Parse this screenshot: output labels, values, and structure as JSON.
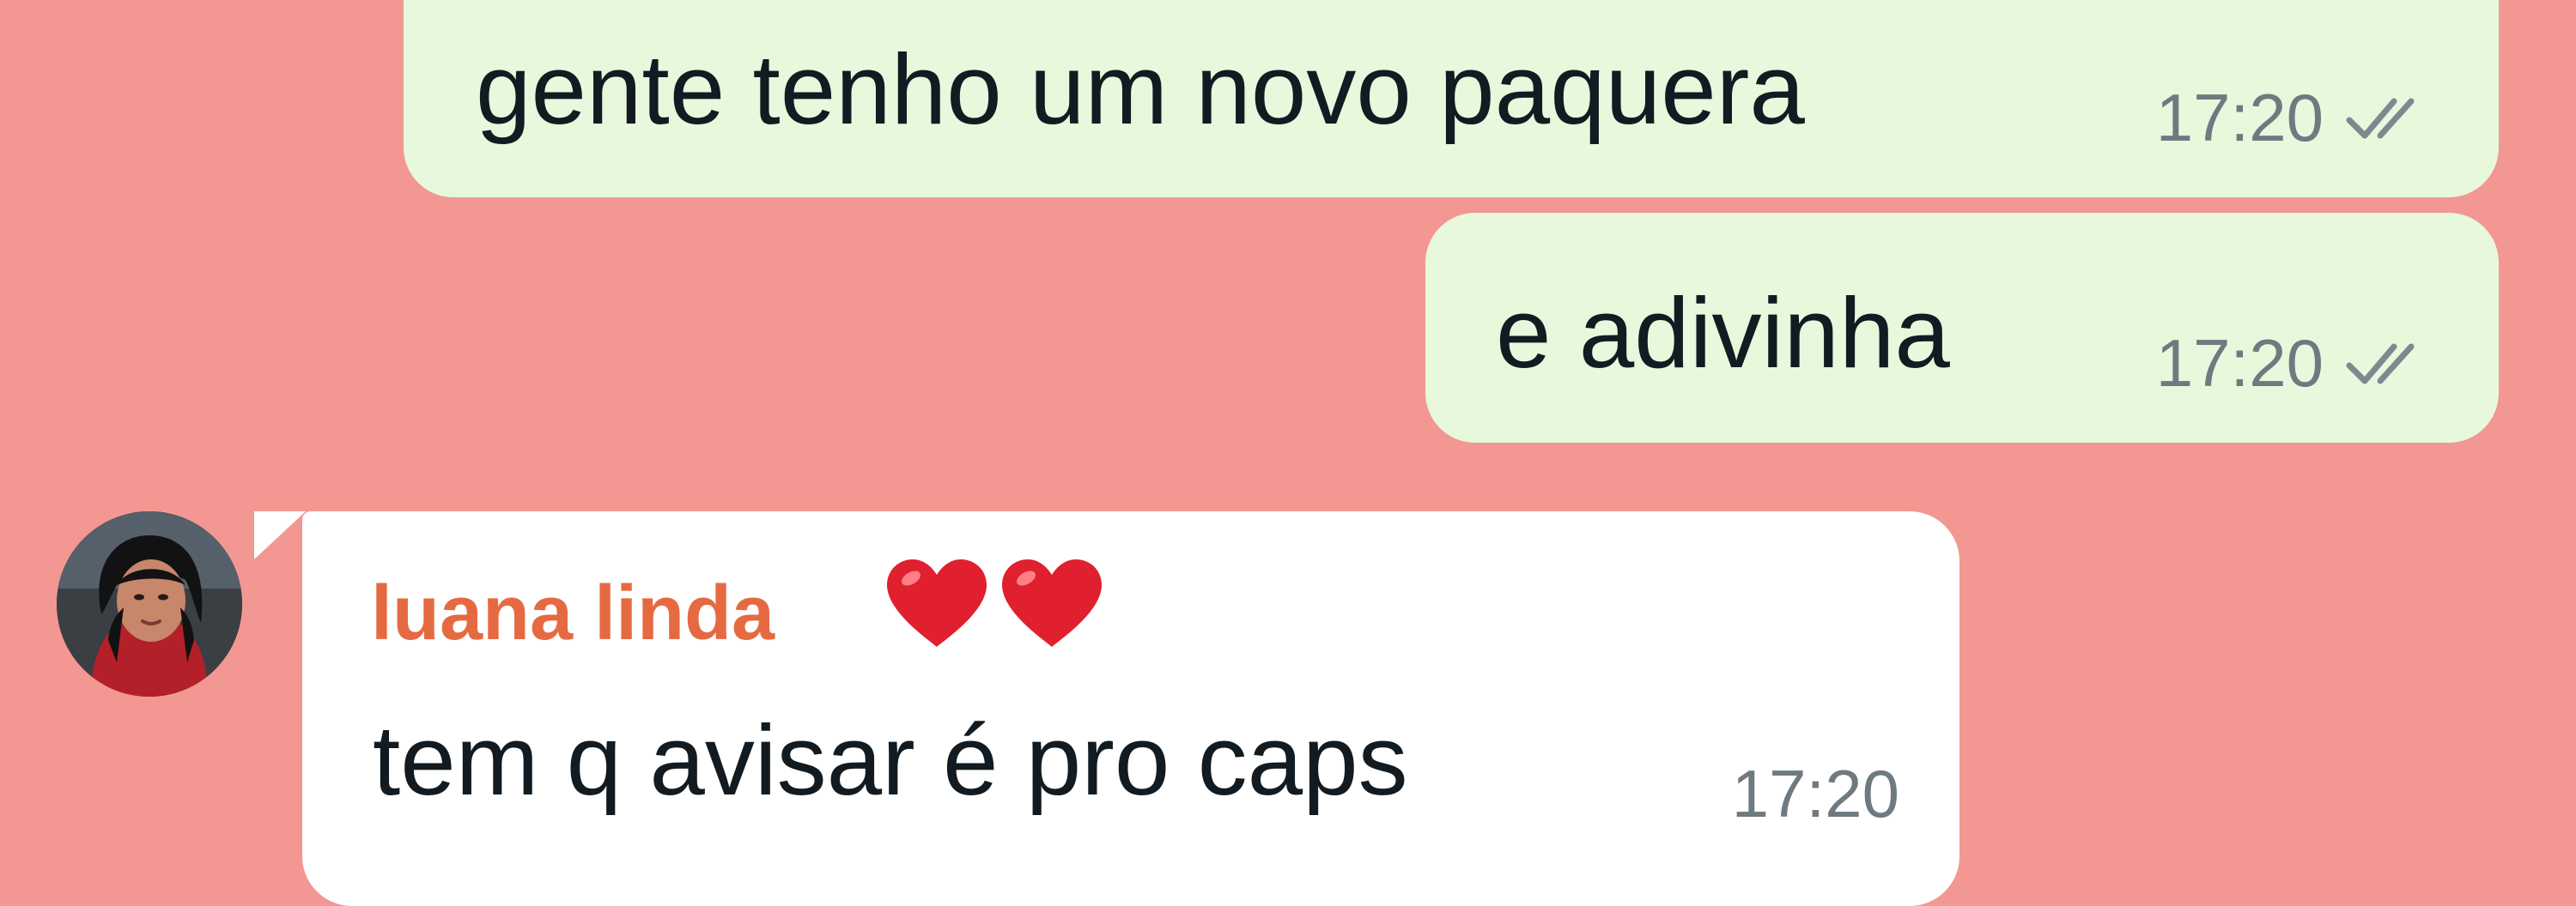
{
  "colors": {
    "chat_background": "#f39792",
    "outgoing_bubble": "#e7f8dc",
    "incoming_bubble": "#ffffff",
    "sender_name": "#e56a42",
    "message_text": "#111b21",
    "timestamp": "#6e7a80",
    "read_ticks": "#7c8a90",
    "heart": "#e0202e"
  },
  "messages": [
    {
      "direction": "outgoing",
      "text": "gente tenho um novo paquera",
      "time": "17:20",
      "status_icon": "double-check-icon"
    },
    {
      "direction": "outgoing",
      "text": "e adivinha",
      "time": "17:20",
      "status_icon": "double-check-icon"
    },
    {
      "direction": "incoming",
      "sender": "luana linda",
      "sender_emoji": [
        "heart-icon",
        "heart-icon"
      ],
      "avatar": "contact-avatar",
      "text": "tem q avisar é pro caps",
      "time": "17:20"
    }
  ]
}
